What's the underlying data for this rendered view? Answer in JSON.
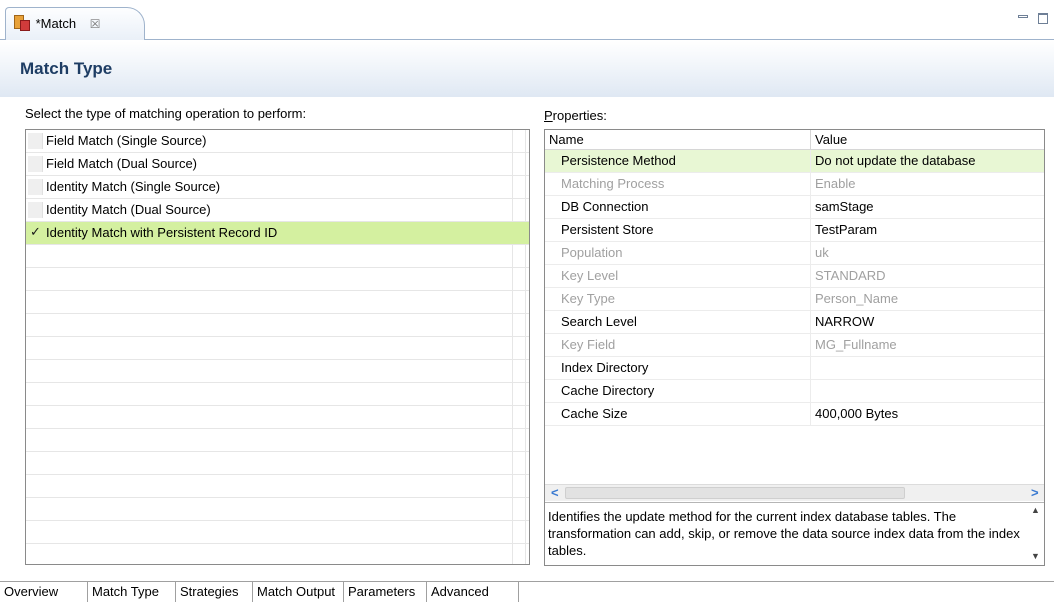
{
  "editor_tab": {
    "title": "*Match",
    "close_glyph": "☒"
  },
  "header": {
    "title": "Match Type"
  },
  "left": {
    "caption": "Select the type of matching operation to perform:",
    "items": [
      {
        "label": "Field Match (Single Source)",
        "selected": false
      },
      {
        "label": "Field Match (Dual Source)",
        "selected": false
      },
      {
        "label": "Identity Match (Single Source)",
        "selected": false
      },
      {
        "label": "Identity Match (Dual Source)",
        "selected": false
      },
      {
        "label": "Identity Match with Persistent Record ID",
        "selected": true,
        "check": "✓"
      }
    ]
  },
  "properties": {
    "caption_mnemonic": "P",
    "caption_rest": "roperties:",
    "headers": {
      "name": "Name",
      "value": "Value"
    },
    "rows": [
      {
        "name": "Persistence Method",
        "value": "Do not update the database",
        "enabled": true,
        "highlighted": true
      },
      {
        "name": "Matching Process",
        "value": "Enable",
        "enabled": false
      },
      {
        "name": "DB Connection",
        "value": "samStage",
        "enabled": true
      },
      {
        "name": "Persistent Store",
        "value": "TestParam",
        "enabled": true
      },
      {
        "name": "Population",
        "value": "uk",
        "enabled": false
      },
      {
        "name": "Key Level",
        "value": "STANDARD",
        "enabled": false
      },
      {
        "name": "Key Type",
        "value": "Person_Name",
        "enabled": false
      },
      {
        "name": "Search Level",
        "value": "NARROW",
        "enabled": true
      },
      {
        "name": "Key Field",
        "value": "MG_Fullname",
        "enabled": false
      },
      {
        "name": "Index Directory",
        "value": "",
        "enabled": true
      },
      {
        "name": "Cache Directory",
        "value": "",
        "enabled": true
      },
      {
        "name": "Cache Size",
        "value": "400,000 Bytes",
        "enabled": true
      }
    ],
    "scroll_left": "<",
    "scroll_right": ">",
    "description": "Identifies the update method for the current index database tables. The transformation can add, skip, or remove the data source index data from the index tables."
  },
  "bottom_tabs": [
    {
      "label": "Overview"
    },
    {
      "label": "Match Type",
      "active": true
    },
    {
      "label": "Strategies"
    },
    {
      "label": "Match Output"
    },
    {
      "label": "Parameters"
    },
    {
      "label": "Advanced"
    }
  ],
  "colors": {
    "selected_row": "#d4f0a0",
    "highlight_row": "#e8f7d4",
    "header_title": "#1e3d64"
  }
}
